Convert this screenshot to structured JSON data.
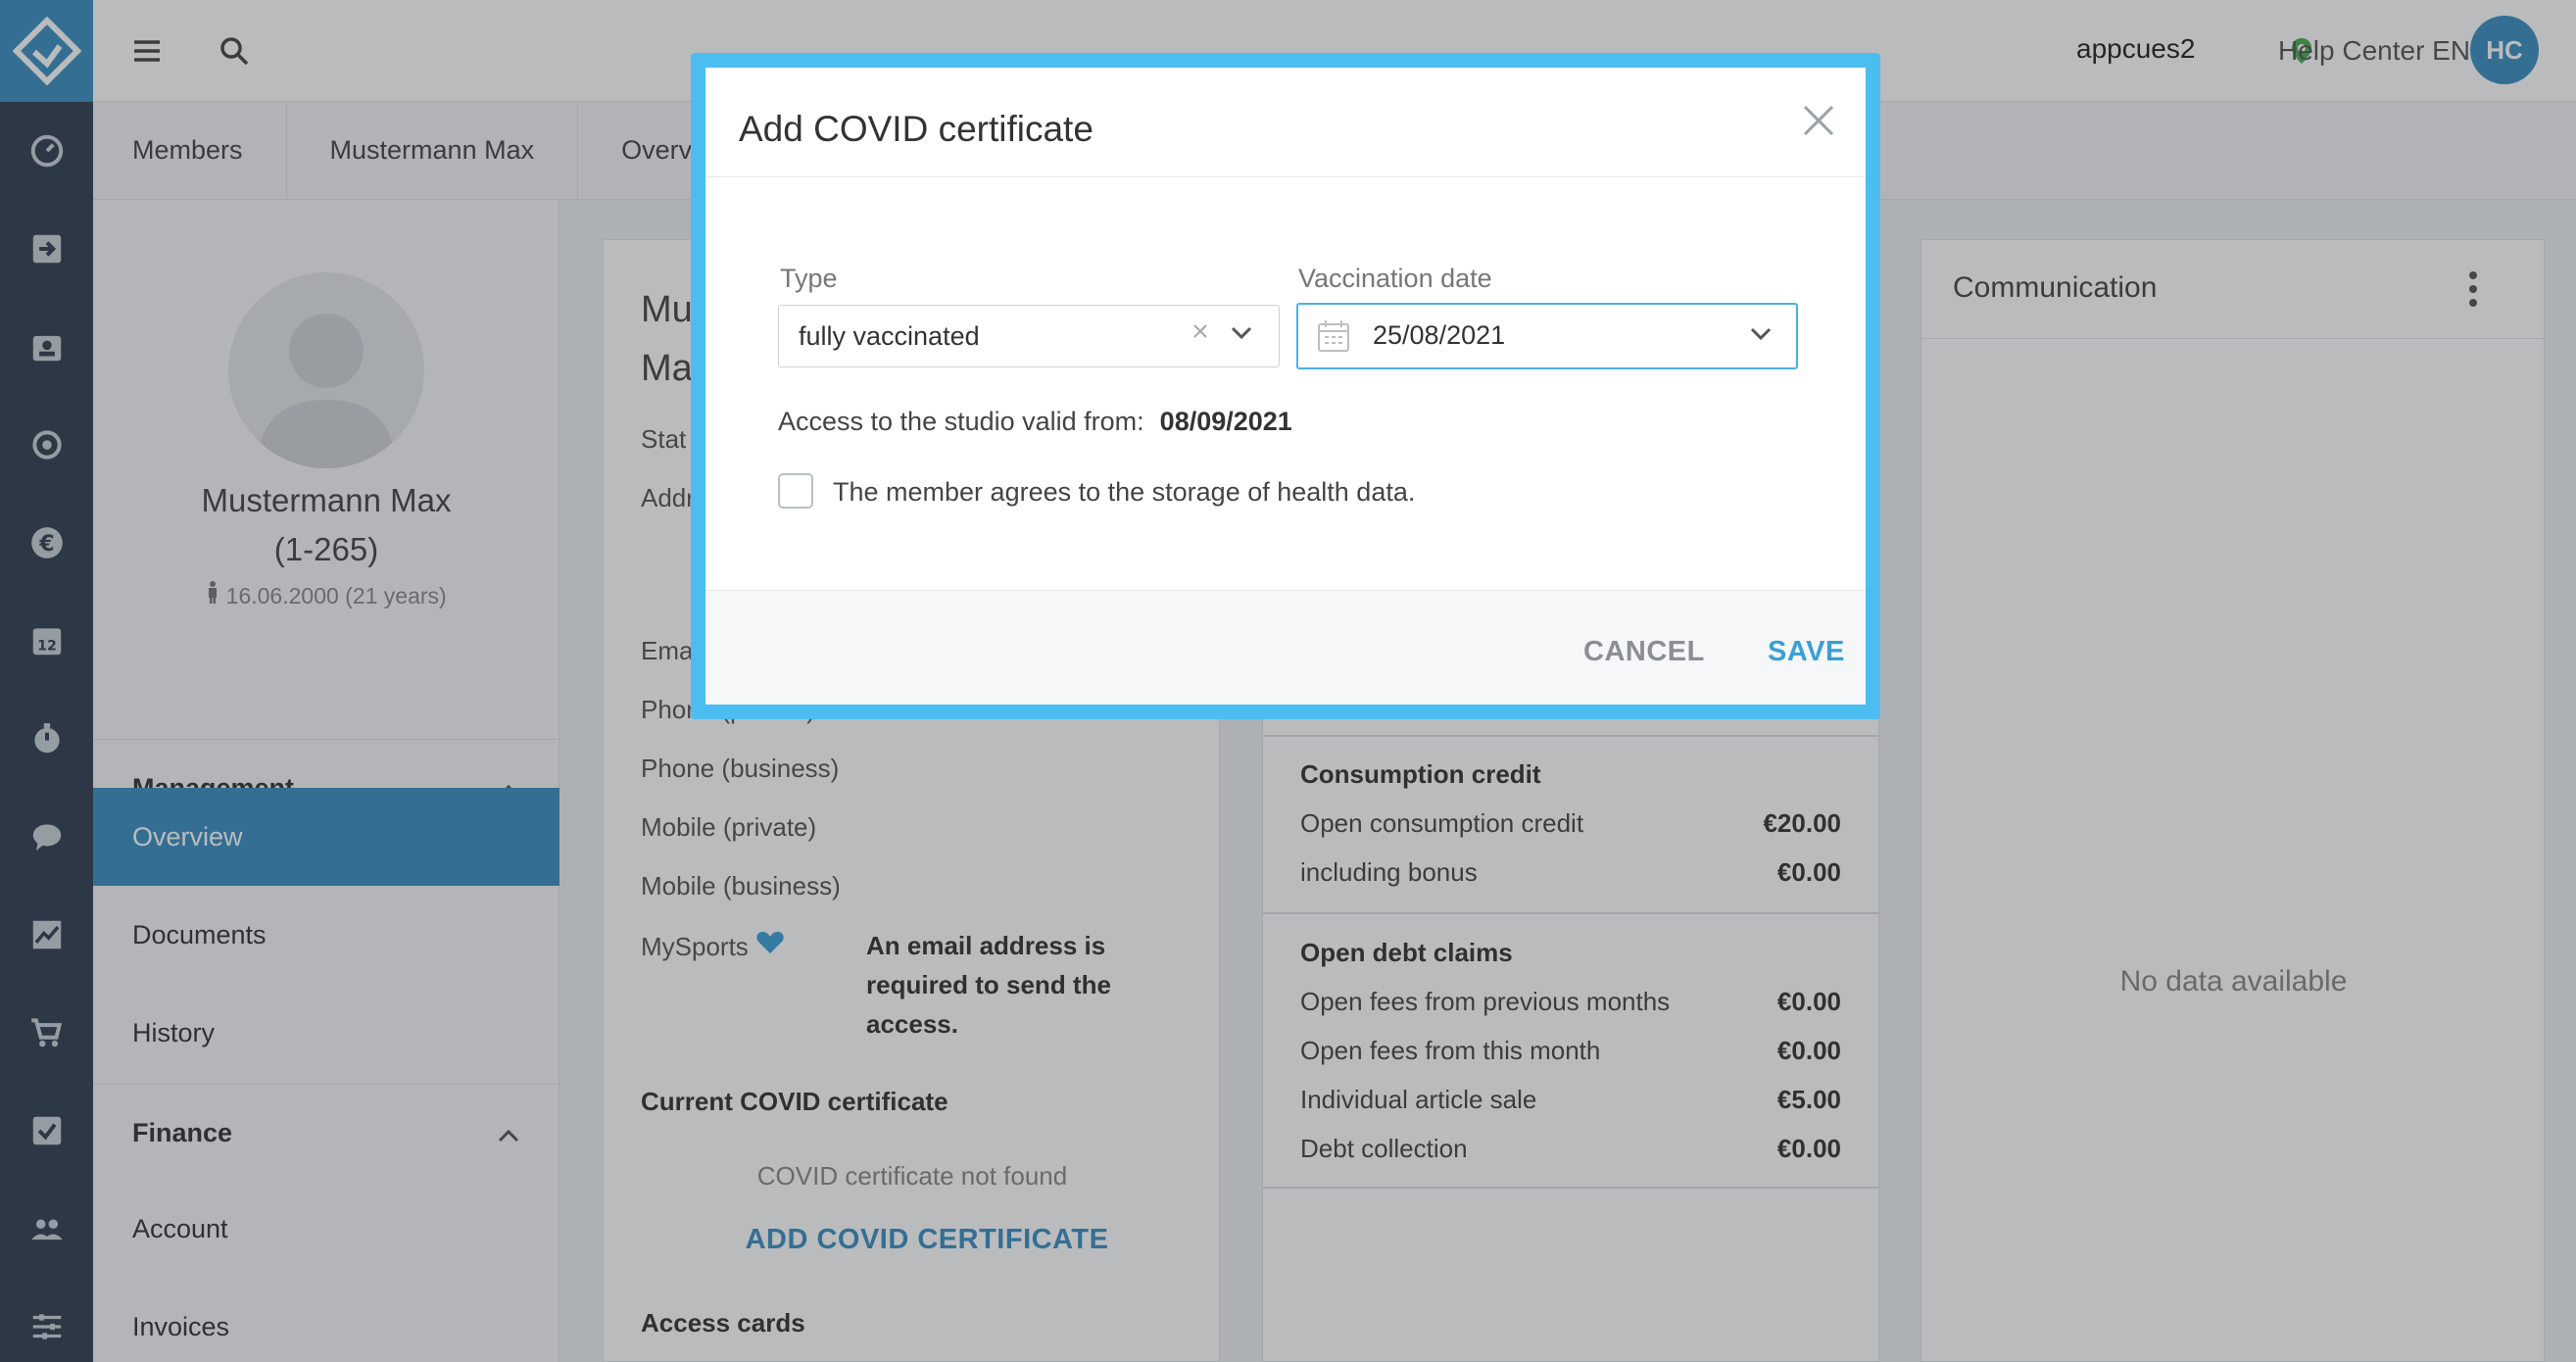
{
  "topbar": {
    "menu_icon": "hamburger-menu-icon",
    "search_icon": "search-icon",
    "user": "appcues2",
    "help": "Help Center EN",
    "avatar_initials": "HC"
  },
  "breadcrumb": [
    "Members",
    "Mustermann Max",
    "Overview"
  ],
  "profile": {
    "name": "Mustermann Max",
    "member_no": "(1-265)",
    "dob": "16.06.2000 (21 years)",
    "sections": [
      {
        "title": "Management",
        "items": [
          "Overview",
          "Documents",
          "History"
        ]
      },
      {
        "title": "Finance",
        "items": [
          "Account",
          "Invoices"
        ]
      }
    ],
    "active_item": "Overview"
  },
  "details": {
    "name_line1": "Mu",
    "name_line2": "Ma",
    "status_label": "Stat",
    "address_label": "Addr",
    "email_label": "Ema",
    "phone_private_label": "Phone (private)",
    "phone_business_label": "Phone (business)",
    "mobile_private_label": "Mobile (private)",
    "mobile_business_label": "Mobile (business)",
    "mysports_label": "MySports",
    "mysports_warning": "An email address is required to send the access.",
    "covid_heading": "Current COVID certificate",
    "covid_not_found": "COVID certificate not found",
    "add_covid": "ADD COVID CERTIFICATE",
    "access_cards_heading": "Access cards"
  },
  "finance": {
    "consumption": {
      "heading": "Consumption credit",
      "rows": [
        {
          "label": "Open consumption credit",
          "value": "€20.00"
        },
        {
          "label": "including bonus",
          "value": "€0.00"
        }
      ]
    },
    "debt": {
      "heading": "Open debt claims",
      "rows": [
        {
          "label": "Open fees from previous months",
          "value": "€0.00"
        },
        {
          "label": "Open fees from this month",
          "value": "€0.00"
        },
        {
          "label": "Individual article sale",
          "value": "€5.00"
        },
        {
          "label": "Debt collection",
          "value": "€0.00"
        }
      ]
    }
  },
  "communication": {
    "title": "Communication",
    "empty": "No data available"
  },
  "modal": {
    "title": "Add COVID certificate",
    "type_label": "Type",
    "type_value": "fully vaccinated",
    "date_label": "Vaccination date",
    "date_value": "25/08/2021",
    "access_text": "Access to the studio valid from:",
    "access_date": "08/09/2021",
    "consent_text": "The member agrees to the storage of health data.",
    "consent_checked": false,
    "cancel": "CANCEL",
    "save": "SAVE"
  },
  "colors": {
    "accent": "#3a8fc1",
    "rail": "#2f3f4e",
    "modal_frame": "#4bbdf0"
  }
}
